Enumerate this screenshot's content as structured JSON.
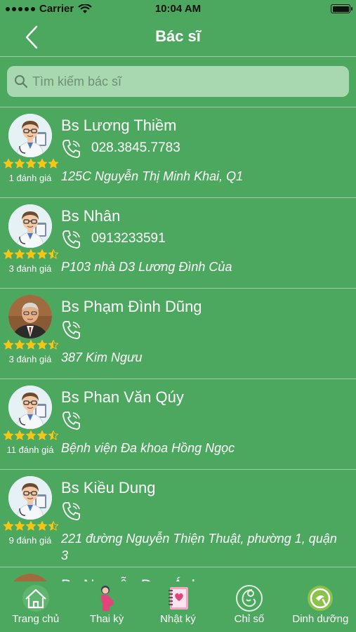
{
  "status_bar": {
    "carrier": "Carrier",
    "time": "10:04 AM"
  },
  "header": {
    "title": "Bác sĩ"
  },
  "search": {
    "placeholder": "Tìm kiếm bác sĩ",
    "value": ""
  },
  "doctors": [
    {
      "name": "Bs Lương Thiềm",
      "phone": "028.3845.7783",
      "address": "125C Nguyễn Thị Minh Khai, Q1",
      "rating": 5,
      "reviews": "1 đánh giá",
      "avatar": "cartoon-doctor"
    },
    {
      "name": "Bs Nhân",
      "phone": "0913233591",
      "address": "P103 nhà D3 Lương Đình Của",
      "rating": 4.5,
      "reviews": "3 đánh giá",
      "avatar": "cartoon-doctor"
    },
    {
      "name": "Bs Phạm Đình Dũng",
      "phone": "",
      "address": "387 Kim Ngưu",
      "rating": 4.5,
      "reviews": "3 đánh giá",
      "avatar": "photo"
    },
    {
      "name": "Bs Phan Văn Qúy",
      "phone": "",
      "address": "Bệnh viện Đa khoa Hồng Ngọc",
      "rating": 4.5,
      "reviews": "11 đánh giá",
      "avatar": "cartoon-doctor"
    },
    {
      "name": "Bs Kiều Dung",
      "phone": "",
      "address": "221 đường Nguyễn Thiện Thuật, phường 1, quận 3",
      "rating": 4.5,
      "reviews": "9 đánh giá",
      "avatar": "cartoon-doctor"
    },
    {
      "name": "Bs Nguyễn Duy Ánh",
      "phone": "",
      "address": "",
      "rating": 0,
      "reviews": "",
      "avatar": "photo"
    }
  ],
  "tabs": [
    {
      "label": "Trang chủ",
      "icon": "home-icon",
      "active": true
    },
    {
      "label": "Thai kỳ",
      "icon": "pregnancy-icon",
      "active": false
    },
    {
      "label": "Nhật ký",
      "icon": "diary-icon",
      "active": false
    },
    {
      "label": "Chỉ số",
      "icon": "fetus-icon",
      "active": false
    },
    {
      "label": "Dinh dưỡng",
      "icon": "nutrition-icon",
      "active": false
    }
  ],
  "colors": {
    "background": "#4ca85e",
    "search_bg": "#a8d8b0",
    "star": "#f5c518",
    "text": "#ffffff"
  }
}
